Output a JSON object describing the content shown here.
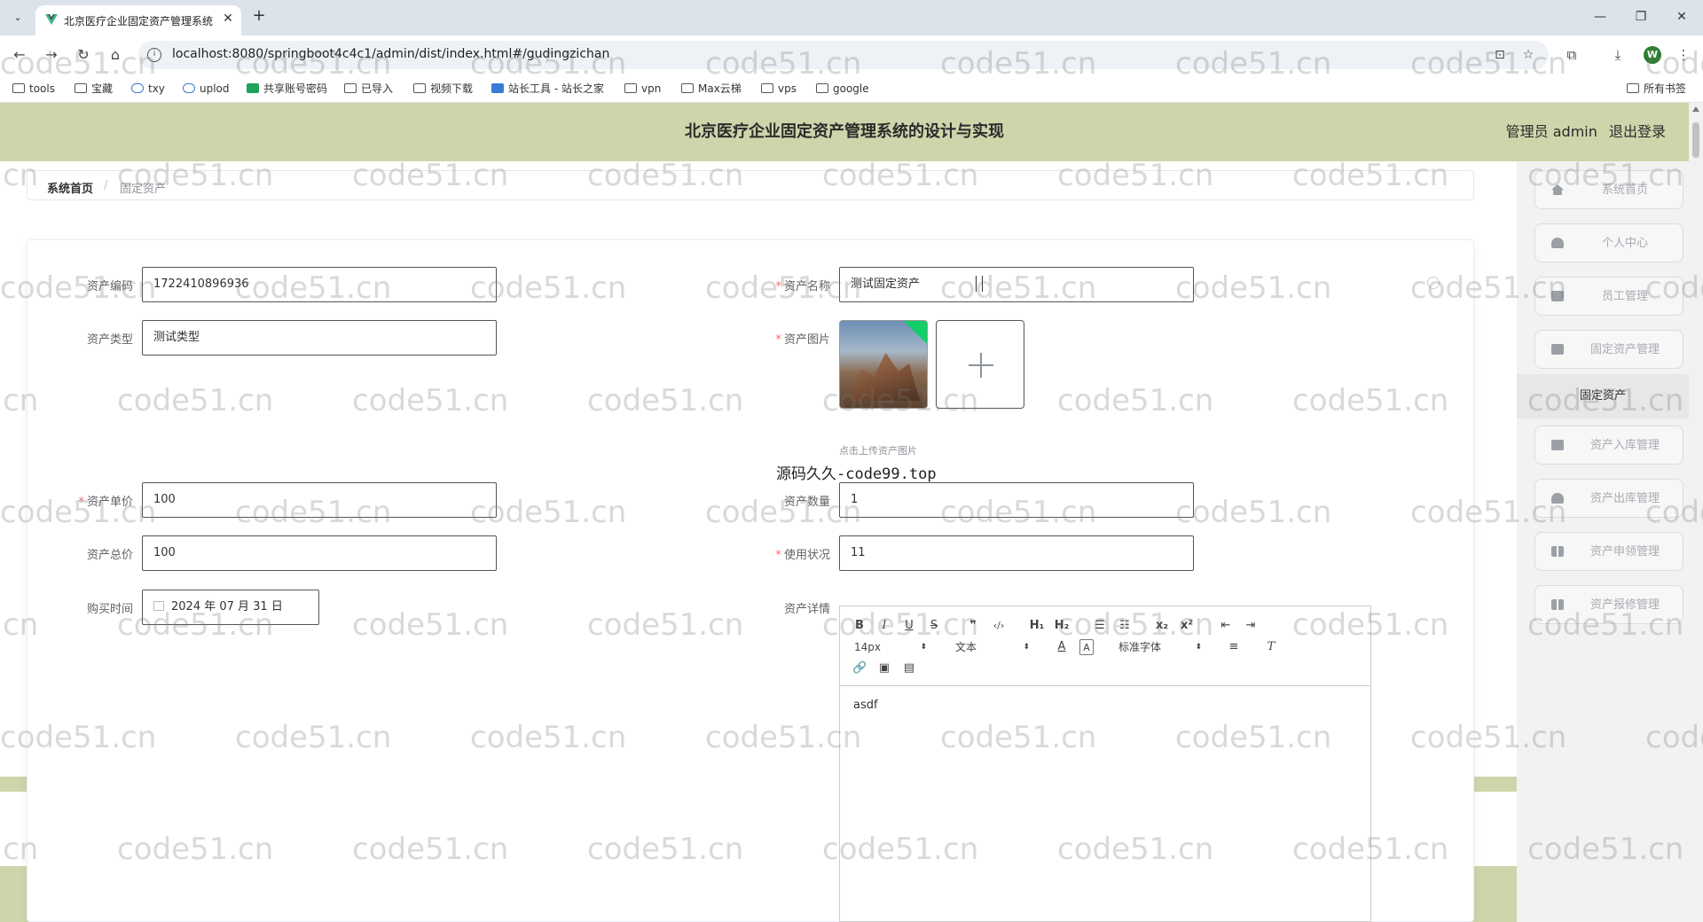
{
  "browser": {
    "tab_title": "北京医疗企业固定资产管理系统",
    "url": "localhost:8080/springboot4c4c1/admin/dist/index.html#/gudingzichan",
    "bookmarks": [
      "tools",
      "宝藏",
      "txy",
      "uplod",
      "共享账号密码",
      "已导入",
      "视频下载",
      "站长工具 - 站长之家",
      "vpn",
      "Max云梯",
      "vps",
      "google"
    ],
    "bookmarks_right": "所有书签",
    "avatar_letter": "W"
  },
  "header": {
    "title": "北京医疗企业固定资产管理系统的设计与实现",
    "user": "管理员 admin",
    "logout": "退出登录"
  },
  "breadcrumb": {
    "home": "系统首页",
    "separator": "/",
    "current": "固定资产"
  },
  "form": {
    "code": {
      "label": "资产编码",
      "value": "1722410896936"
    },
    "name": {
      "label": "资产名称",
      "value": "测试固定资产"
    },
    "type": {
      "label": "资产类型",
      "value": "测试类型"
    },
    "image": {
      "label": "资产图片",
      "tip": "点击上传资产图片"
    },
    "price": {
      "label": "资产单价",
      "value": "100"
    },
    "quantity": {
      "label": "资产数量",
      "value": "1"
    },
    "total": {
      "label": "资产总价",
      "value": "100"
    },
    "status": {
      "label": "使用状况",
      "value": "11"
    },
    "purchase_time": {
      "label": "购买时间",
      "value": "2024 年 07 月 31 日"
    },
    "detail": {
      "label": "资产详情",
      "content": "asdf"
    }
  },
  "source_note": "源码久久-code99.top",
  "editor_toolbar": {
    "font_size": "14px",
    "block": "文本",
    "font_family": "标准字体"
  },
  "sidebar": {
    "items": [
      {
        "label": "系统首页",
        "icon": "home-icon"
      },
      {
        "label": "个人中心",
        "icon": "user-icon"
      },
      {
        "label": "员工管理",
        "icon": "users-icon"
      },
      {
        "label": "固定资产管理",
        "icon": "asset-icon"
      }
    ],
    "active_sub": "固定资产",
    "items_after": [
      {
        "label": "资产入库管理",
        "icon": "inbound-icon"
      },
      {
        "label": "资产出库管理",
        "icon": "outbound-icon"
      },
      {
        "label": "资产申领管理",
        "icon": "apply-icon"
      },
      {
        "label": "资产报修管理",
        "icon": "repair-icon"
      }
    ]
  },
  "watermark": "code51.cn",
  "colors": {
    "header_bg": "#cdd6ab",
    "required": "#f56c6c",
    "thumb_badge": "#13ce66"
  }
}
